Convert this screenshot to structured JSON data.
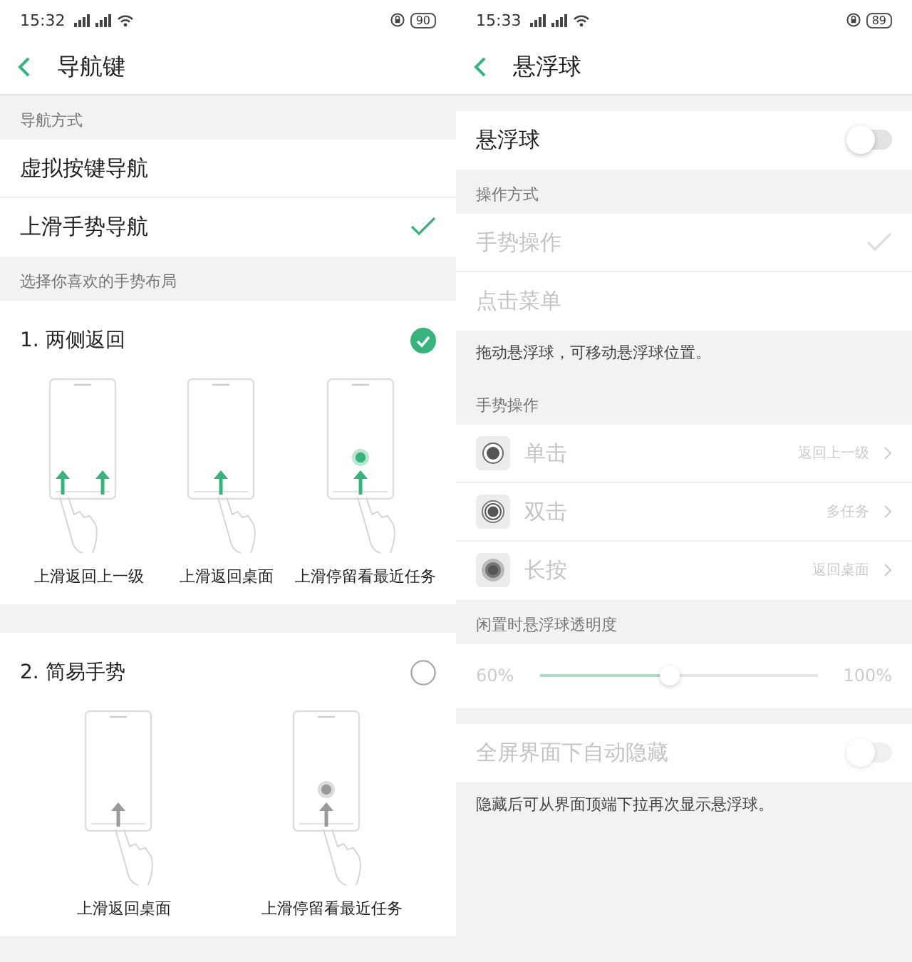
{
  "navigation_screen": {
    "status_bar": {
      "time": "15:32",
      "battery": "90"
    },
    "title": "导航键",
    "method_header": "导航方式",
    "methods": [
      {
        "label": "虚拟按键导航",
        "selected": false
      },
      {
        "label": "上滑手势导航",
        "selected": true
      }
    ],
    "layout_header": "选择你喜欢的手势布局",
    "layouts": [
      {
        "title": "1. 两侧返回",
        "selected": true,
        "gestures": [
          {
            "kind": "side",
            "label": "上滑返回上一级"
          },
          {
            "kind": "home",
            "label": "上滑返回桌面"
          },
          {
            "kind": "recent",
            "label": "上滑停留看最近任务"
          }
        ]
      },
      {
        "title": "2. 简易手势",
        "selected": false,
        "gestures": [
          {
            "kind": "home",
            "label": "上滑返回桌面"
          },
          {
            "kind": "recent",
            "label": "上滑停留看最近任务"
          }
        ]
      }
    ]
  },
  "floating_ball_screen": {
    "status_bar": {
      "time": "15:33",
      "battery": "89"
    },
    "title": "悬浮球",
    "main_toggle": {
      "label": "悬浮球",
      "on": false
    },
    "mode_header": "操作方式",
    "modes": [
      {
        "label": "手势操作",
        "selected": true
      },
      {
        "label": "点击菜单",
        "selected": false
      }
    ],
    "mode_note": "拖动悬浮球，可移动悬浮球位置。",
    "gesture_header": "手势操作",
    "gestures": [
      {
        "kind": "tap",
        "label": "单击",
        "value": "返回上一级"
      },
      {
        "kind": "double",
        "label": "双击",
        "value": "多任务"
      },
      {
        "kind": "long",
        "label": "长按",
        "value": "返回桌面"
      }
    ],
    "opacity_header": "闲置时悬浮球透明度",
    "opacity": {
      "min": "60%",
      "max": "100%",
      "level": 0.47
    },
    "auto_hide": {
      "label": "全屏界面下自动隐藏",
      "on": false
    },
    "auto_hide_note": "隐藏后可从界面顶端下拉再次显示悬浮球。"
  }
}
